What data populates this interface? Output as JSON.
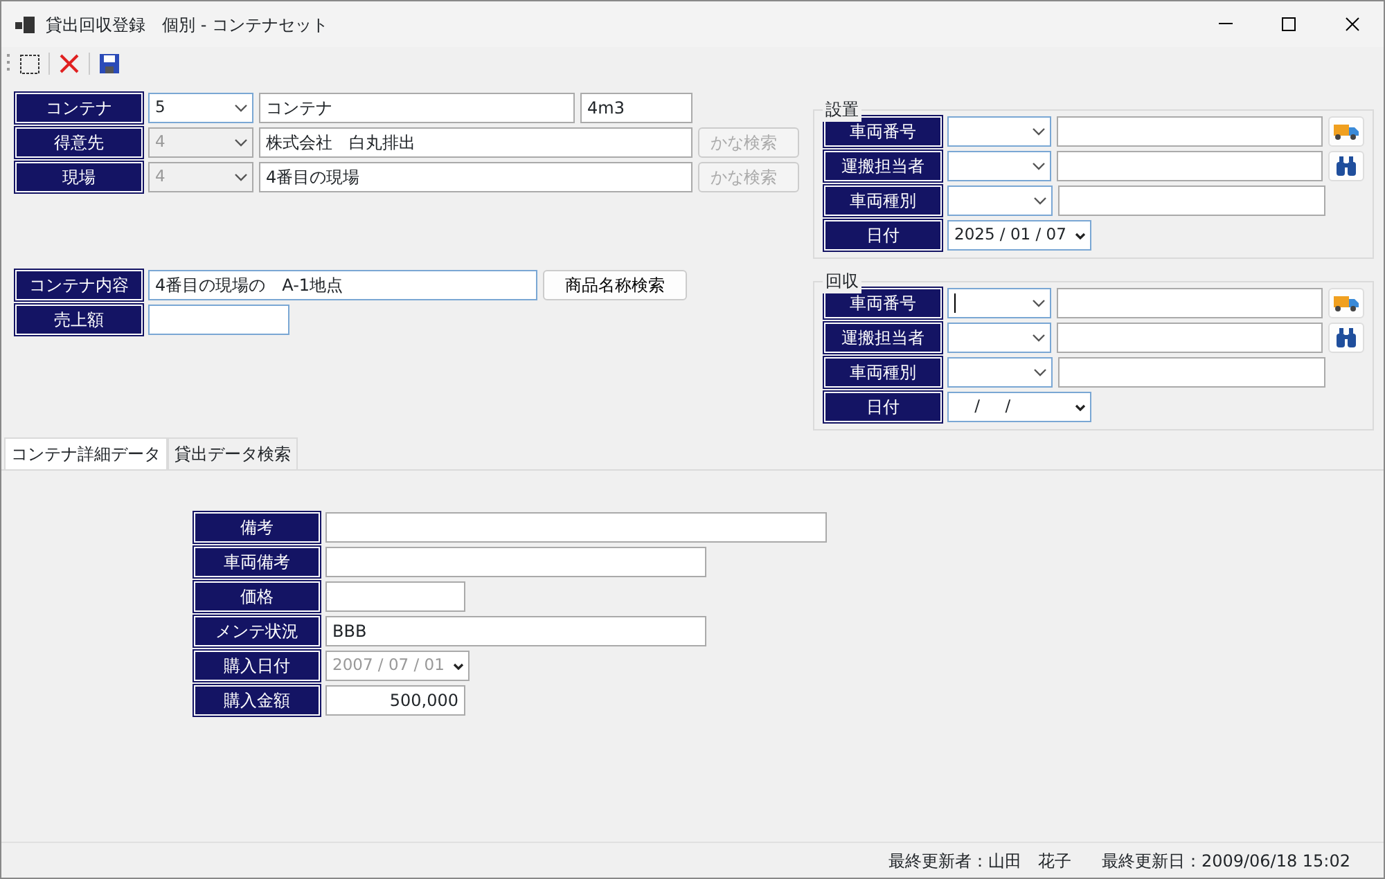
{
  "window": {
    "title": "貸出回収登録　個別 - コンテナセット"
  },
  "form": {
    "container": {
      "label": "コンテナ",
      "code": "5",
      "name": "コンテナ",
      "size": "4m3"
    },
    "customer": {
      "label": "得意先",
      "code": "4",
      "code_disabled": true,
      "name": "株式会社　白丸排出",
      "button": "かな検索",
      "button_disabled": true
    },
    "site": {
      "label": "現場",
      "code": "4",
      "code_disabled": true,
      "name": "4番目の現場",
      "button": "かな検索",
      "button_disabled": true
    },
    "content": {
      "label": "コンテナ内容",
      "value": "4番目の現場の　A-1地点",
      "button": "商品名称検索"
    },
    "sales": {
      "label": "売上額"
    }
  },
  "groups": [
    {
      "title": "設置",
      "rows": [
        {
          "label": "車両番号",
          "kind": "truck"
        },
        {
          "label": "運搬担当者",
          "kind": "search"
        },
        {
          "label": "車両種別",
          "kind": "plain"
        },
        {
          "label": "日付",
          "kind": "date",
          "value": "2025 / 01 / 07"
        }
      ]
    },
    {
      "title": "回収",
      "rows": [
        {
          "label": "車両番号",
          "kind": "truck",
          "focused": true
        },
        {
          "label": "運搬担当者",
          "kind": "search"
        },
        {
          "label": "車両種別",
          "kind": "plain"
        },
        {
          "label": "日付",
          "kind": "date",
          "value": "    /     /"
        }
      ]
    }
  ],
  "tabs": [
    {
      "label": "コンテナ詳細データ",
      "selected": true
    },
    {
      "label": "貸出データ検索",
      "selected": false
    }
  ],
  "details": [
    {
      "label": "備考",
      "kind": "text"
    },
    {
      "label": "車両備考",
      "kind": "text"
    },
    {
      "label": "価格",
      "kind": "text"
    },
    {
      "label": "メンテ状況",
      "kind": "text",
      "value": "BBB"
    },
    {
      "label": "購入日付",
      "kind": "date",
      "value": "2007 / 07 / 01",
      "disabled": true
    },
    {
      "label": "購入金額",
      "kind": "amount",
      "value": "500,000"
    }
  ],
  "status_bar": [
    "最終更新者：山田　花子",
    "最終更新日：2009/06/18 15:02"
  ]
}
